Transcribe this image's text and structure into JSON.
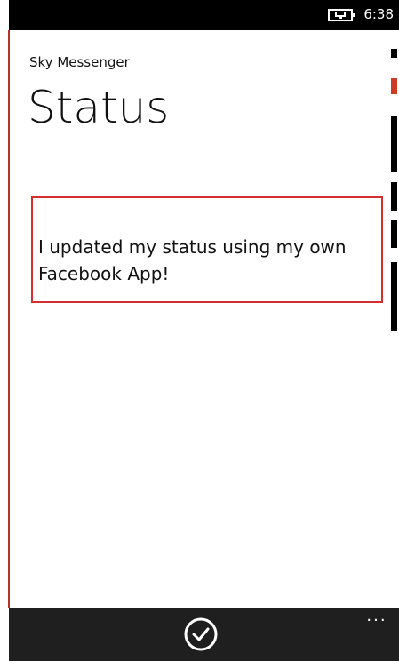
{
  "status_bar": {
    "time": "6:38",
    "battery_icon": "battery-charging-icon"
  },
  "app": {
    "title": "Sky Messenger"
  },
  "page": {
    "title": "Status"
  },
  "status_input": {
    "value": "I updated my status using my own Facebook App!"
  },
  "app_bar": {
    "ok_icon": "check-circle-icon",
    "more_label": "..."
  },
  "colors": {
    "accent": "#d32f2f",
    "status_bar": "#000000",
    "app_bar": "#1f1f1f"
  }
}
